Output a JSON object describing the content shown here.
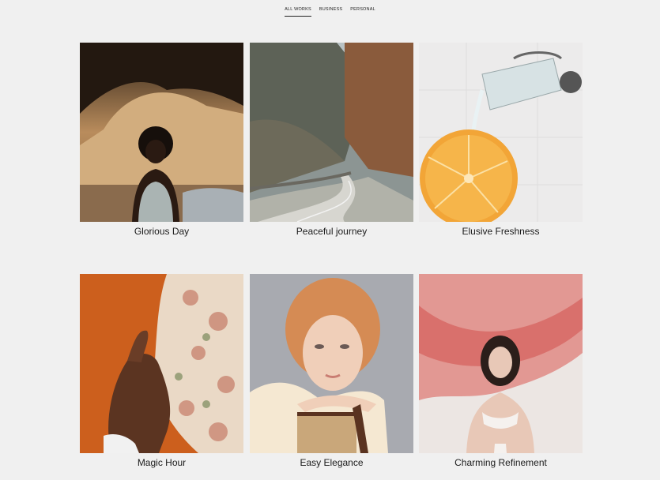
{
  "nav": {
    "tabs": [
      {
        "label": "ALL WORKS",
        "active": true
      },
      {
        "label": "BUSINESS",
        "active": false
      },
      {
        "label": "PERSONAL",
        "active": false
      }
    ]
  },
  "works": [
    {
      "title": "Glorious Day"
    },
    {
      "title": "Peaceful journey"
    },
    {
      "title": "Elusive Freshness"
    },
    {
      "title": "Magic Hour"
    },
    {
      "title": "Easy Elegance"
    },
    {
      "title": "Charming Refinement"
    }
  ],
  "colors": {
    "background": "#f0f0f0",
    "text": "#1b1b1b"
  }
}
